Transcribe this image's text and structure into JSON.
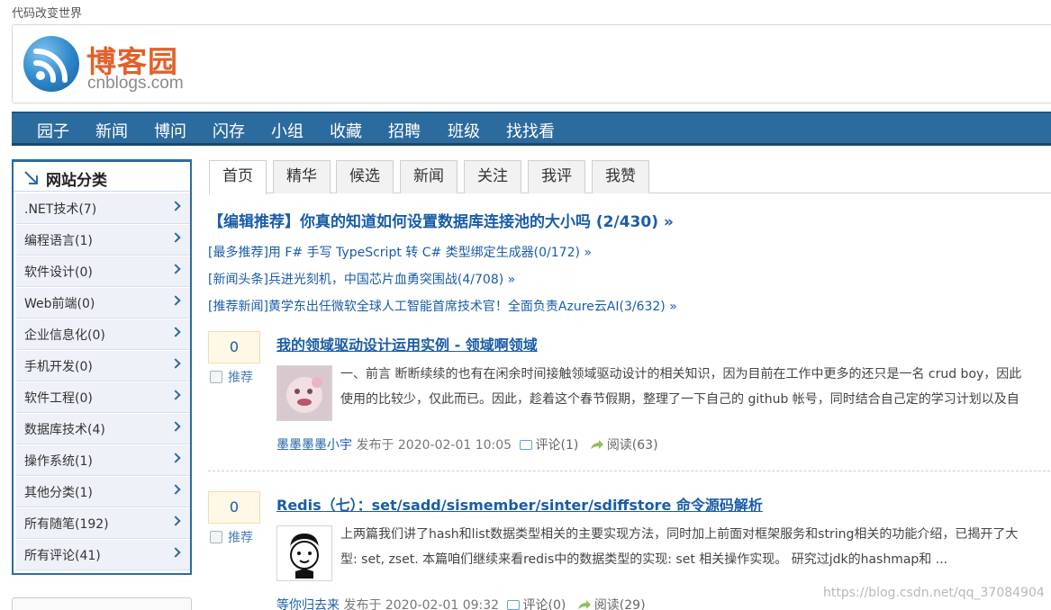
{
  "page": {
    "tagline": "代码改变世界",
    "watermark": "https://blog.csdn.net/qq_37084904"
  },
  "logo": {
    "name": "博客园",
    "domain": "cnblogs.com",
    "icon": "rss-logo-icon"
  },
  "nav": {
    "items": [
      "园子",
      "新闻",
      "博问",
      "闪存",
      "小组",
      "收藏",
      "招聘",
      "班级",
      "找找看"
    ]
  },
  "sidebar": {
    "title": "网站分类",
    "items": [
      ".NET技术(7)",
      "编程语言(1)",
      "软件设计(0)",
      "Web前端(0)",
      "企业信息化(0)",
      "手机开发(0)",
      "软件工程(0)",
      "数据库技术(4)",
      "操作系统(1)",
      "其他分类(1)",
      "所有随笔(192)",
      "所有评论(41)"
    ]
  },
  "tabs": {
    "items": [
      "首页",
      "精华",
      "候选",
      "新闻",
      "关注",
      "我评",
      "我赞"
    ],
    "active": "首页"
  },
  "headlines": {
    "main": "【编辑推荐】你真的知道如何设置数据库连接池的大小吗 (2/430) »",
    "subs": [
      "[最多推荐]用 F# 手写 TypeScript 转 C# 类型绑定生成器(0/172) »",
      "[新闻头条]兵进光刻机，中国芯片血勇突围战(4/708) »",
      "[推荐新闻]黄学东出任微软全球人工智能首席技术官！全面负责Azure云AI(3/632) »"
    ]
  },
  "posts": [
    {
      "digg": "0",
      "recommend": "推荐",
      "title": "我的领域驱动设计运用实例 - 领域啊领域",
      "summary": [
        "一、前言 断断续续的也有在闲余时间接触领域驱动设计的相关知识，因为目前在工作中更多的还只是一名 crud boy，因此",
        "使用的比较少，仅此而已。因此，趁着这个春节假期，整理了一下自己的 github 帐号，同时结合自己定的学习计划以及自"
      ],
      "author": "墨墨墨墨小宇",
      "published": "发布于 2020-02-01 10:05",
      "comments": "评论(1)",
      "reads": "阅读(63)"
    },
    {
      "digg": "0",
      "recommend": "推荐",
      "title": "Redis（七）：set/sadd/sismember/sinter/sdiffstore 命令源码解析",
      "summary": [
        "上两篇我们讲了hash和list数据类型相关的主要实现方法，同时加上前面对框架服务和string相关的功能介绍，已揭开了大",
        "型: set, zset. 本篇咱们继续来看redis中的数据类型的实现: set 相关操作实现。 研究过jdk的hashmap和 ..."
      ],
      "author": "等你归去来",
      "published": "发布于 2020-02-01 09:32",
      "comments": "评论(0)",
      "reads": "阅读(29)"
    }
  ]
}
